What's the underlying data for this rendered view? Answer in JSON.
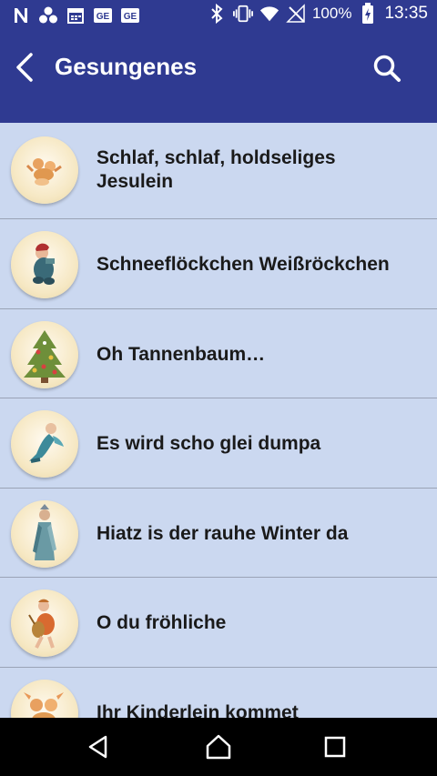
{
  "status": {
    "battery": "100%",
    "time": "13:35",
    "left_icons": [
      "notification-n-icon",
      "app-cluster-icon",
      "calendar-icon",
      "ge-icon",
      "ge-icon"
    ],
    "right_icons": [
      "bluetooth-icon",
      "vibrate-icon",
      "wifi-icon",
      "no-signal-icon",
      "battery-charging-icon"
    ]
  },
  "appbar": {
    "title": "Gesungenes",
    "back_icon": "back-arrow-icon",
    "search_icon": "search-icon"
  },
  "songs": [
    {
      "title_line1": "Schlaf, schlaf, holdseliges",
      "title_line2": "Jesulein",
      "thumbnail": "cherubs"
    },
    {
      "title": "Schneeflöckchen Weißröckchen",
      "thumbnail": "child-in-snow"
    },
    {
      "title": "Oh Tannenbaum…",
      "thumbnail": "christmas-tree"
    },
    {
      "title": "Es wird scho glei dumpa",
      "thumbnail": "flying-angel"
    },
    {
      "title": "Hiatz is der rauhe Winter da",
      "thumbnail": "standing-figure"
    },
    {
      "title": "O du fröhliche",
      "thumbnail": "angel-with-lute"
    },
    {
      "title": "Ihr Kinderlein kommet",
      "thumbnail": "cherubs"
    }
  ],
  "colors": {
    "appbar": "#2f3a91",
    "list_background": "#cbd8f0",
    "divider": "#9aa3b6"
  },
  "navbar": {
    "icons": [
      "back-triangle-icon",
      "home-icon",
      "recents-icon"
    ]
  }
}
